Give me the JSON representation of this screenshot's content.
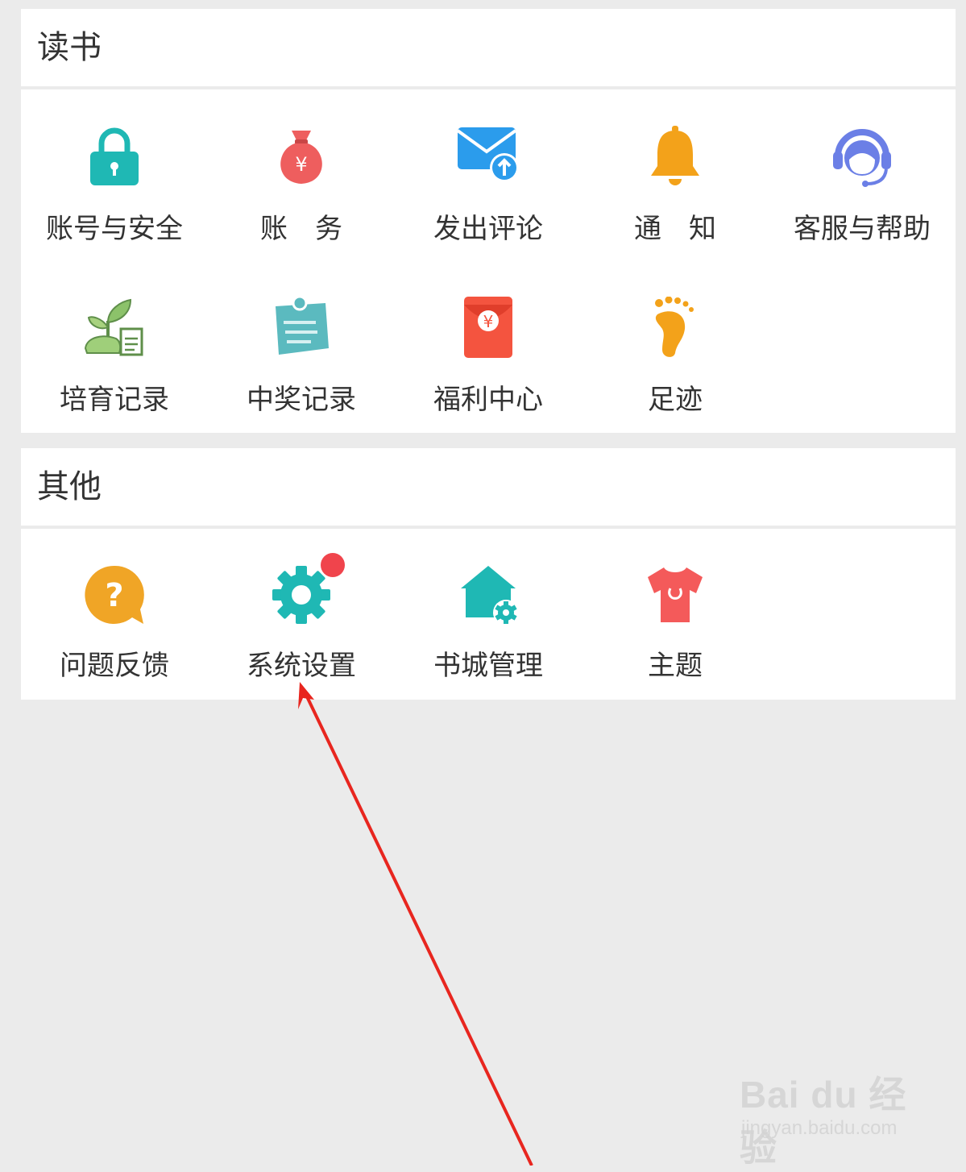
{
  "sections": {
    "reading": {
      "title": "读书"
    },
    "other": {
      "title": "其他"
    }
  },
  "reading_items": [
    {
      "label": "账号与安全",
      "icon": "padlock-icon",
      "color": "#1fb8b4"
    },
    {
      "label": "账　务",
      "icon": "money-bag-icon",
      "color": "#ee5e5e"
    },
    {
      "label": "发出评论",
      "icon": "mail-upload-icon",
      "color": "#2b9cec"
    },
    {
      "label": "通　知",
      "icon": "bell-icon",
      "color": "#f3a21a"
    },
    {
      "label": "客服与帮助",
      "icon": "headset-support-icon",
      "color": "#6b7fe6"
    },
    {
      "label": "培育记录",
      "icon": "sprout-icon",
      "color": "#6fa058"
    },
    {
      "label": "中奖记录",
      "icon": "clipboard-note-icon",
      "color": "#5bbabf"
    },
    {
      "label": "福利中心",
      "icon": "red-envelope-icon",
      "color": "#f4543f"
    },
    {
      "label": "足迹",
      "icon": "footprint-icon",
      "color": "#f3a21a"
    }
  ],
  "other_items": [
    {
      "label": "问题反馈",
      "icon": "question-bubble-icon",
      "color": "#f0a526"
    },
    {
      "label": "系统设置",
      "icon": "gear-icon",
      "color": "#1fb8b4",
      "badge": true
    },
    {
      "label": "书城管理",
      "icon": "house-gear-icon",
      "color": "#1fb8b4"
    },
    {
      "label": "主题",
      "icon": "tshirt-icon",
      "color": "#f45a5a"
    }
  ],
  "colors": {
    "annotation_arrow": "#e8261f",
    "badge": "#f0444c"
  },
  "watermark": {
    "logo": "Bai du 经验",
    "sub": "jingyan.baidu.com"
  }
}
